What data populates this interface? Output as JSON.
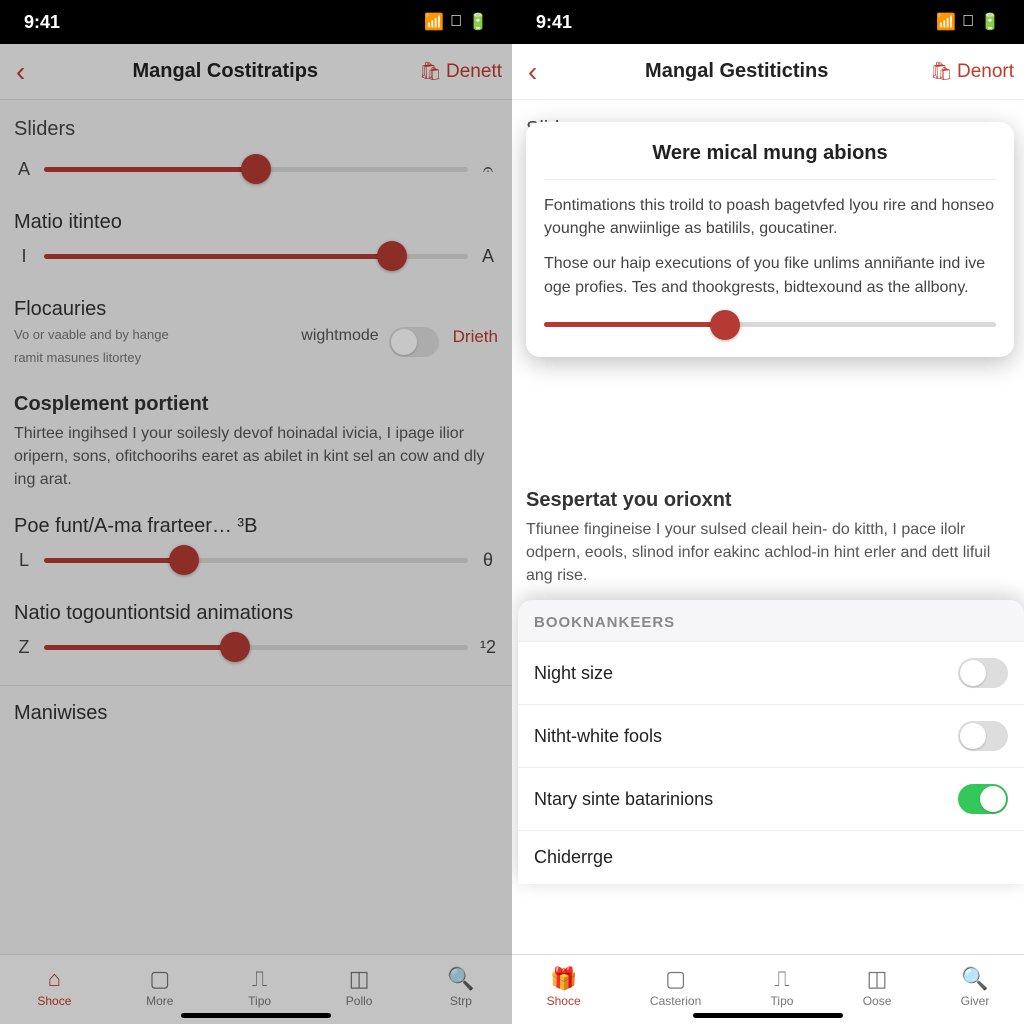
{
  "status": {
    "time": "9:41"
  },
  "left": {
    "nav": {
      "title": "Mangal Costitratips",
      "action": "Denett"
    },
    "sliders_label": "Sliders",
    "slider1": {
      "left": "A",
      "right": "𝄐",
      "pct": 50
    },
    "sub1": "Matio itinteo",
    "slider2": {
      "left": "I",
      "right": "A",
      "pct": 82
    },
    "flocauries": {
      "title": "Flocauries",
      "line1": "Vo or vaable and by hange",
      "line2": "ramit masunes litortey",
      "mode": "wightmode",
      "link": "Drieth"
    },
    "cosp": {
      "title": "Cosplement portient",
      "para": "Thirtee ingihsed I your soilesly devof hoinadal ivicia, I ipage ilior oripern, sons, ofitchoorihs earet as abilet in kint sel an cow and dly ing arat."
    },
    "poe": {
      "title": "Poe funt/A-ma frarteer…  ³B",
      "slider": {
        "left": "L",
        "right": "θ",
        "pct": 33
      }
    },
    "natio": {
      "title": "Natio togountiontsid animations",
      "slider": {
        "left": "Z",
        "right": "¹2",
        "pct": 45
      }
    },
    "maniwises": "Maniwises",
    "tabs": [
      "Shoce",
      "More",
      "Tipo",
      "Pollo",
      "Strp"
    ]
  },
  "right": {
    "nav": {
      "title": "Mangal Gestitictins",
      "action": "Denort"
    },
    "sliders_label": "Sliders",
    "card": {
      "title": "Were mical mung abions",
      "p1": "Fontimations this troild to poash bagetvfed lyou rire and honseo younghe anwiinlige as batilils, goucatiner.",
      "p2": "Those our haip executions of you fike unlims anniñante ind ive oge profies. Tes and thookgrests, bidtexound as the allbony.",
      "slider_pct": 40
    },
    "sesp": {
      "title": "Sespertat you orioxnt",
      "para": "Tfiunee fingineise I your sulsed cleail hein- do kitth, I pace ilolr odpern, eools, slinod infor eakinc achlod-in hint erler and dett lifuil ang rise."
    },
    "sheet": {
      "header": "BOOKNANKEERS",
      "rows": [
        {
          "label": "Night size",
          "on": false
        },
        {
          "label": "Nitht-white fools",
          "on": false
        },
        {
          "label": "Ntary sinte batarinions",
          "on": true
        },
        {
          "label": "Chiderrge",
          "on": null
        }
      ]
    },
    "tabs": [
      "Shoce",
      "Casterion",
      "Tipo",
      "Oose",
      "Giver"
    ]
  }
}
